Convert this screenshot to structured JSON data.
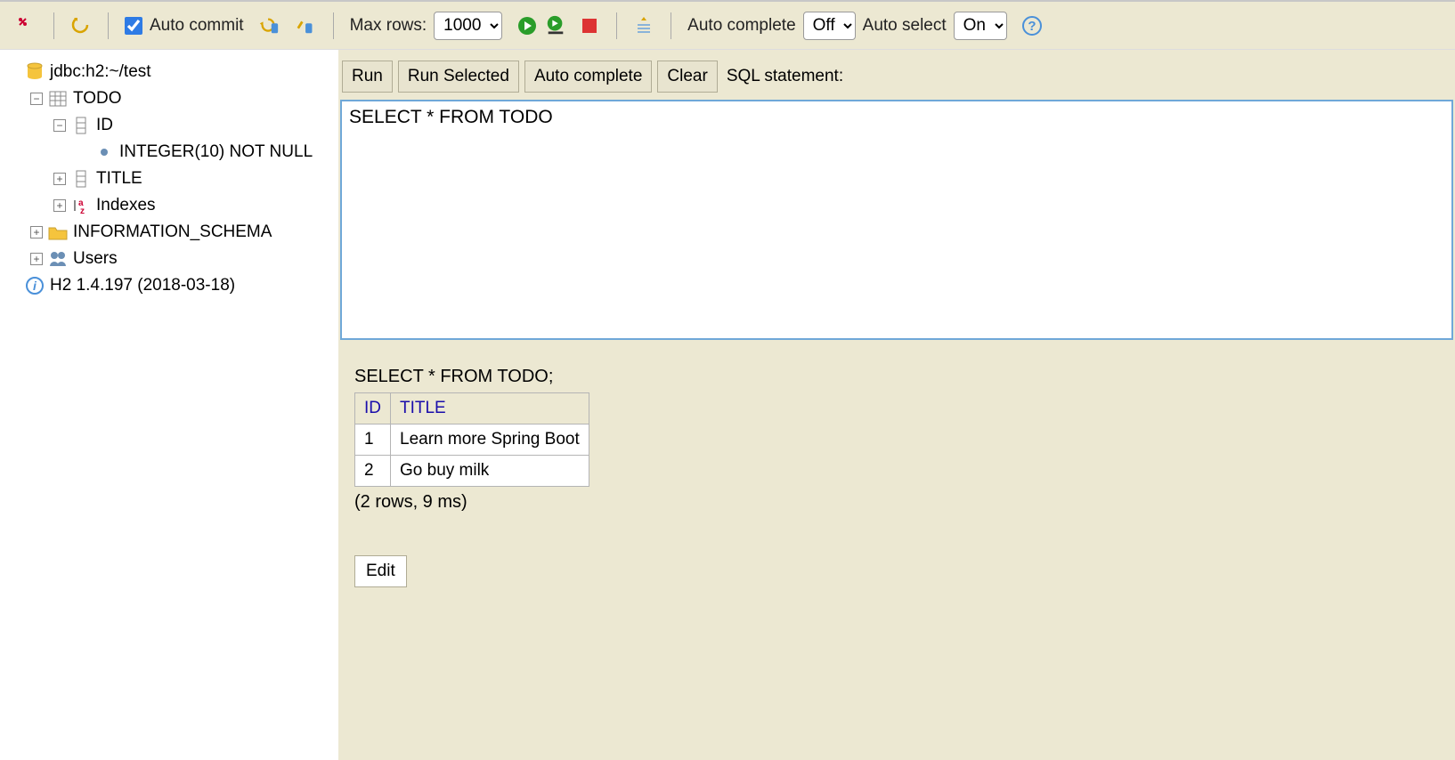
{
  "toolbar": {
    "auto_commit_label": "Auto commit",
    "max_rows_label": "Max rows:",
    "max_rows_value": "1000",
    "auto_complete_label": "Auto complete",
    "auto_complete_value": "Off",
    "auto_select_label": "Auto select",
    "auto_select_value": "On"
  },
  "tree": {
    "db_url": "jdbc:h2:~/test",
    "table": "TODO",
    "col_id": "ID",
    "col_id_type": "INTEGER(10) NOT NULL",
    "col_title": "TITLE",
    "indexes": "Indexes",
    "info_schema": "INFORMATION_SCHEMA",
    "users": "Users",
    "version": "H2 1.4.197 (2018-03-18)"
  },
  "actions": {
    "run": "Run",
    "run_selected": "Run Selected",
    "auto_complete": "Auto complete",
    "clear": "Clear",
    "sql_label": "SQL statement:"
  },
  "editor": {
    "sql": "SELECT * FROM TODO"
  },
  "result": {
    "executed_sql": "SELECT * FROM TODO;",
    "headers": {
      "id": "ID",
      "title": "TITLE"
    },
    "rows": [
      {
        "id": "1",
        "title": "Learn more Spring Boot"
      },
      {
        "id": "2",
        "title": "Go buy milk"
      }
    ],
    "stats": "(2 rows, 9 ms)",
    "edit": "Edit"
  }
}
